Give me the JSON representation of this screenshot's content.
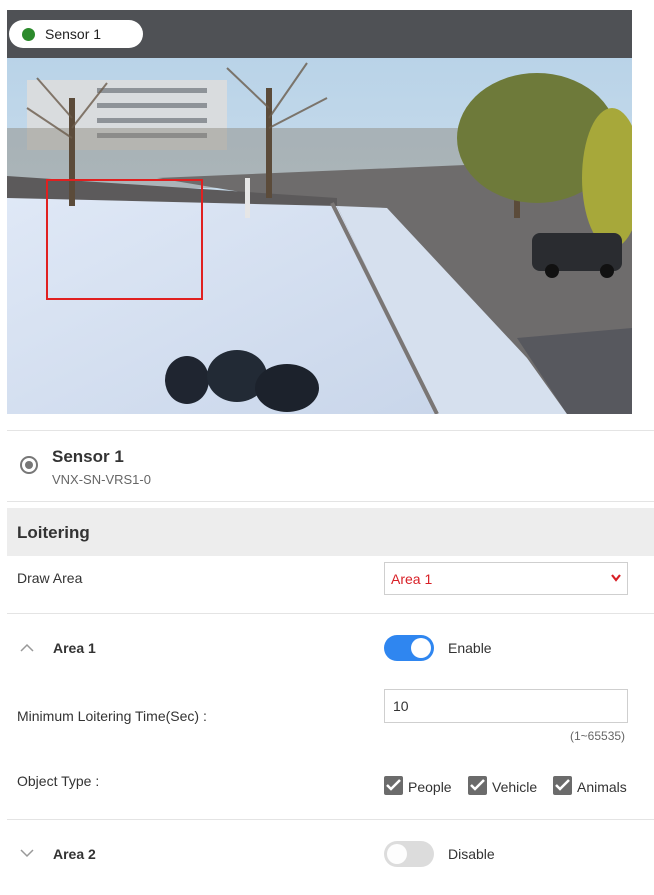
{
  "camera": {
    "status_color": "#2c8a2c",
    "name": "Sensor 1"
  },
  "sensor": {
    "title": "Sensor 1",
    "id": "VNX-SN-VRS1-0"
  },
  "section": {
    "title": "Loitering"
  },
  "draw_area": {
    "label": "Draw Area",
    "selected": "Area 1",
    "accent_color": "#d81f26"
  },
  "area1": {
    "title": "Area 1",
    "toggle_state": "Enable",
    "enabled": true,
    "min_time_label": "Minimum Loitering Time(Sec) :",
    "min_time_value": "10",
    "range_hint": "(1~65535)",
    "object_type_label": "Object Type :",
    "object_types": [
      {
        "label": "People",
        "checked": true
      },
      {
        "label": "Vehicle",
        "checked": true
      },
      {
        "label": "Animals",
        "checked": true
      }
    ]
  },
  "area2": {
    "title": "Area 2",
    "toggle_state": "Disable",
    "enabled": false
  },
  "colors": {
    "toggle_on": "#2f86f0",
    "toggle_off": "#dcdcdc",
    "area_box": "#e02020"
  }
}
